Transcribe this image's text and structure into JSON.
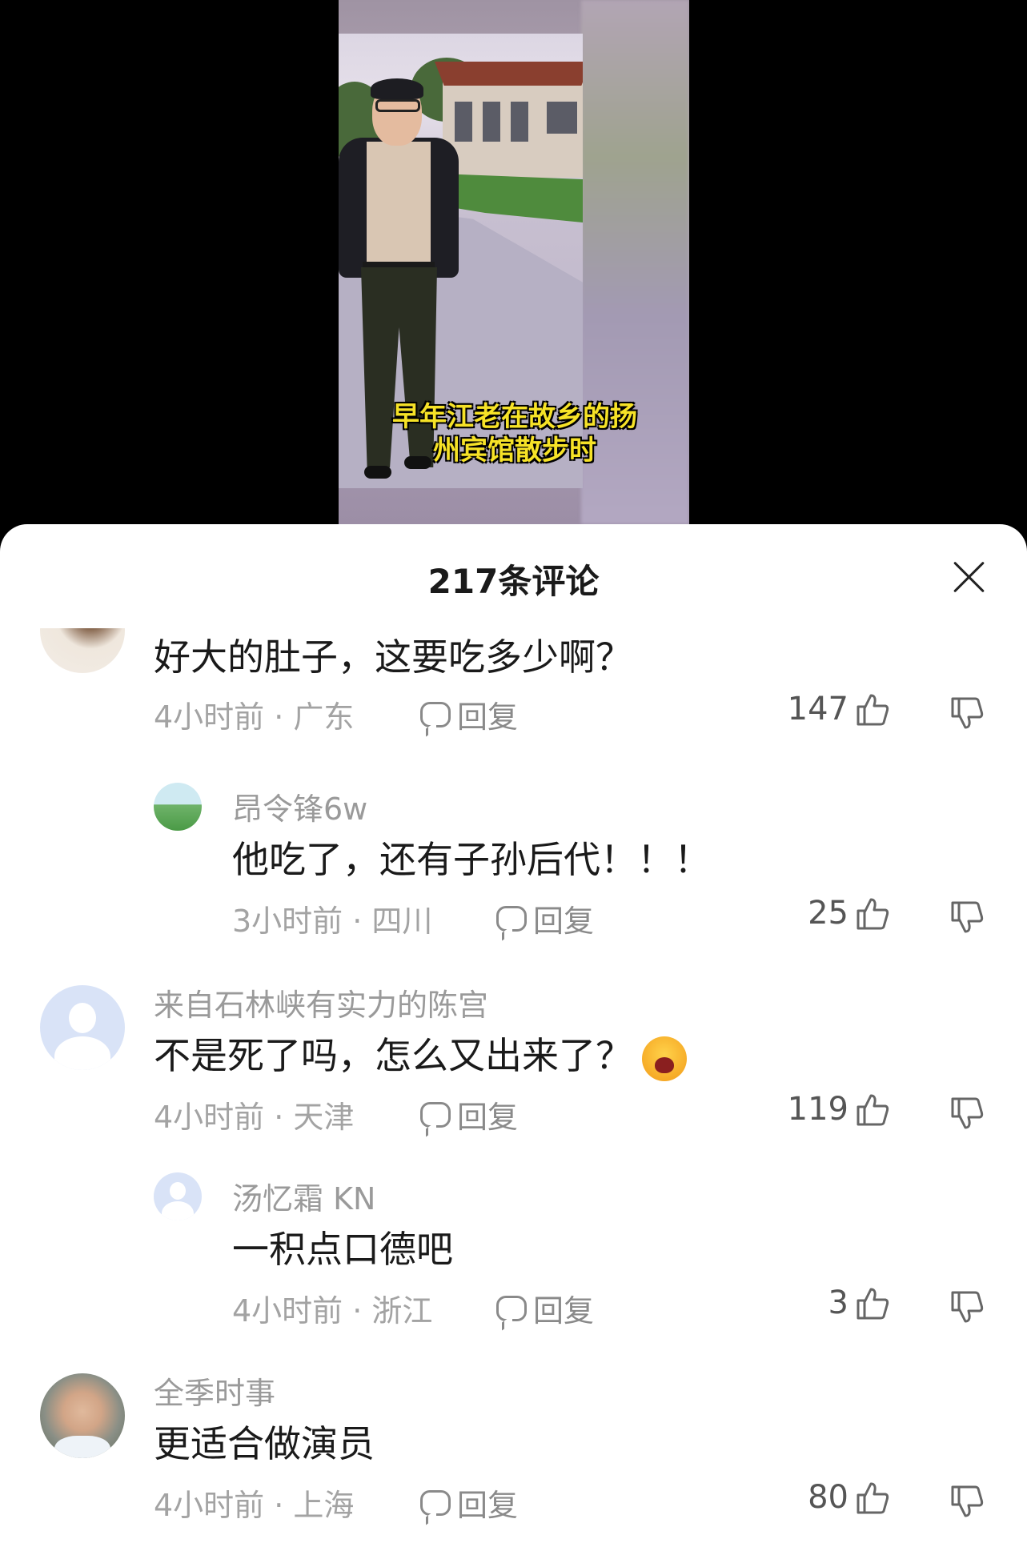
{
  "video": {
    "caption_line1": "早年江老在故乡的扬",
    "caption_line2": "州宾馆散步时"
  },
  "panel": {
    "title": "217条评论",
    "close_icon": "close-icon"
  },
  "comments": [
    {
      "username": "",
      "content": "好大的肚子，这要吃多少啊？",
      "time_location": "4小时前 · 广东",
      "reply_label": "回复",
      "likes": "147"
    },
    {
      "username": "昂令锋6w",
      "content": "他吃了，还有子孙后代！！！",
      "time_location": "3小时前 · 四川",
      "reply_label": "回复",
      "likes": "25"
    },
    {
      "username": "来自石林峡有实力的陈宫",
      "content": "不是死了吗，怎么又出来了？",
      "emoji": "crying-laughing-emoji",
      "time_location": "4小时前 · 天津",
      "reply_label": "回复",
      "likes": "119"
    },
    {
      "username": "汤忆霜 KN",
      "content": "一积点口德吧",
      "time_location": "4小时前 · 浙江",
      "reply_label": "回复",
      "likes": "3"
    },
    {
      "username": "全季时事",
      "content": "更适合做演员",
      "time_location": "4小时前 · 上海",
      "reply_label": "回复",
      "likes": "80"
    }
  ],
  "colors": {
    "caption": "#f6e227",
    "meta": "#a3a3a3",
    "text": "#1a1a1a"
  }
}
